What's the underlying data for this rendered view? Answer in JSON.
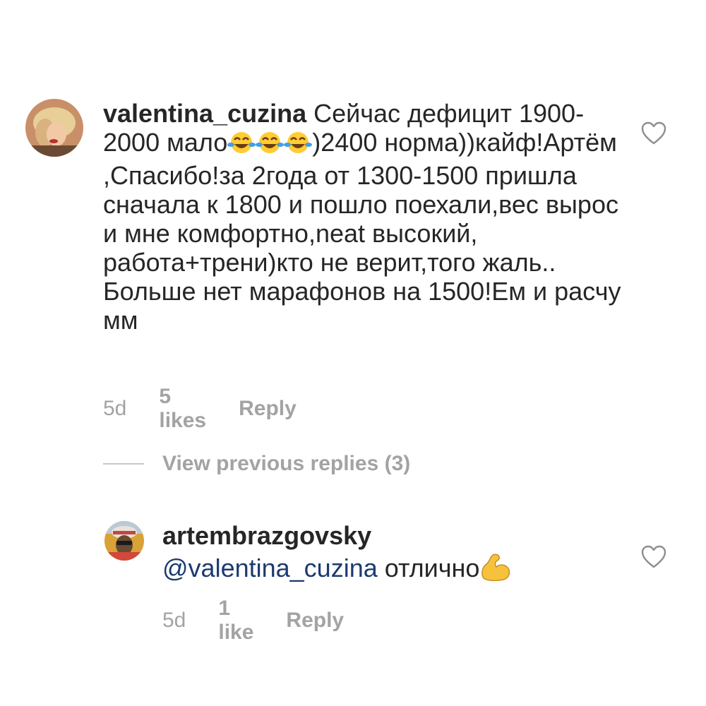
{
  "comments": [
    {
      "username": "valentina_cuzina",
      "text_part1": " Сейчас дефицит 1900-2000 мало",
      "emoji1": "face-with-tears-of-joy",
      "text_part2": ")2400 норма))кайф!Артём ,Спасибо!за 2года от 1300-1500 пришла сначала к 1800 и пошло поехали,вес вырос и мне комфортно,neat высокий, работа+трени)кто не верит,того жаль.. Больше нет марафонов на 1500!Ем и расчу мм",
      "time": "5d",
      "likes": "5 likes",
      "reply": "Reply"
    },
    {
      "username": "artembrazgovsky",
      "mention": "@valentina_cuzina",
      "text": " отлично",
      "emoji": "flexed-biceps",
      "time": "5d",
      "likes": "1 like",
      "reply": "Reply"
    }
  ],
  "view_replies": "View previous replies (3)",
  "icons": {
    "like": "heart-outline-icon"
  },
  "colors": {
    "text": "#262626",
    "meta": "#a3a3a3",
    "mention": "#1c3a70"
  }
}
